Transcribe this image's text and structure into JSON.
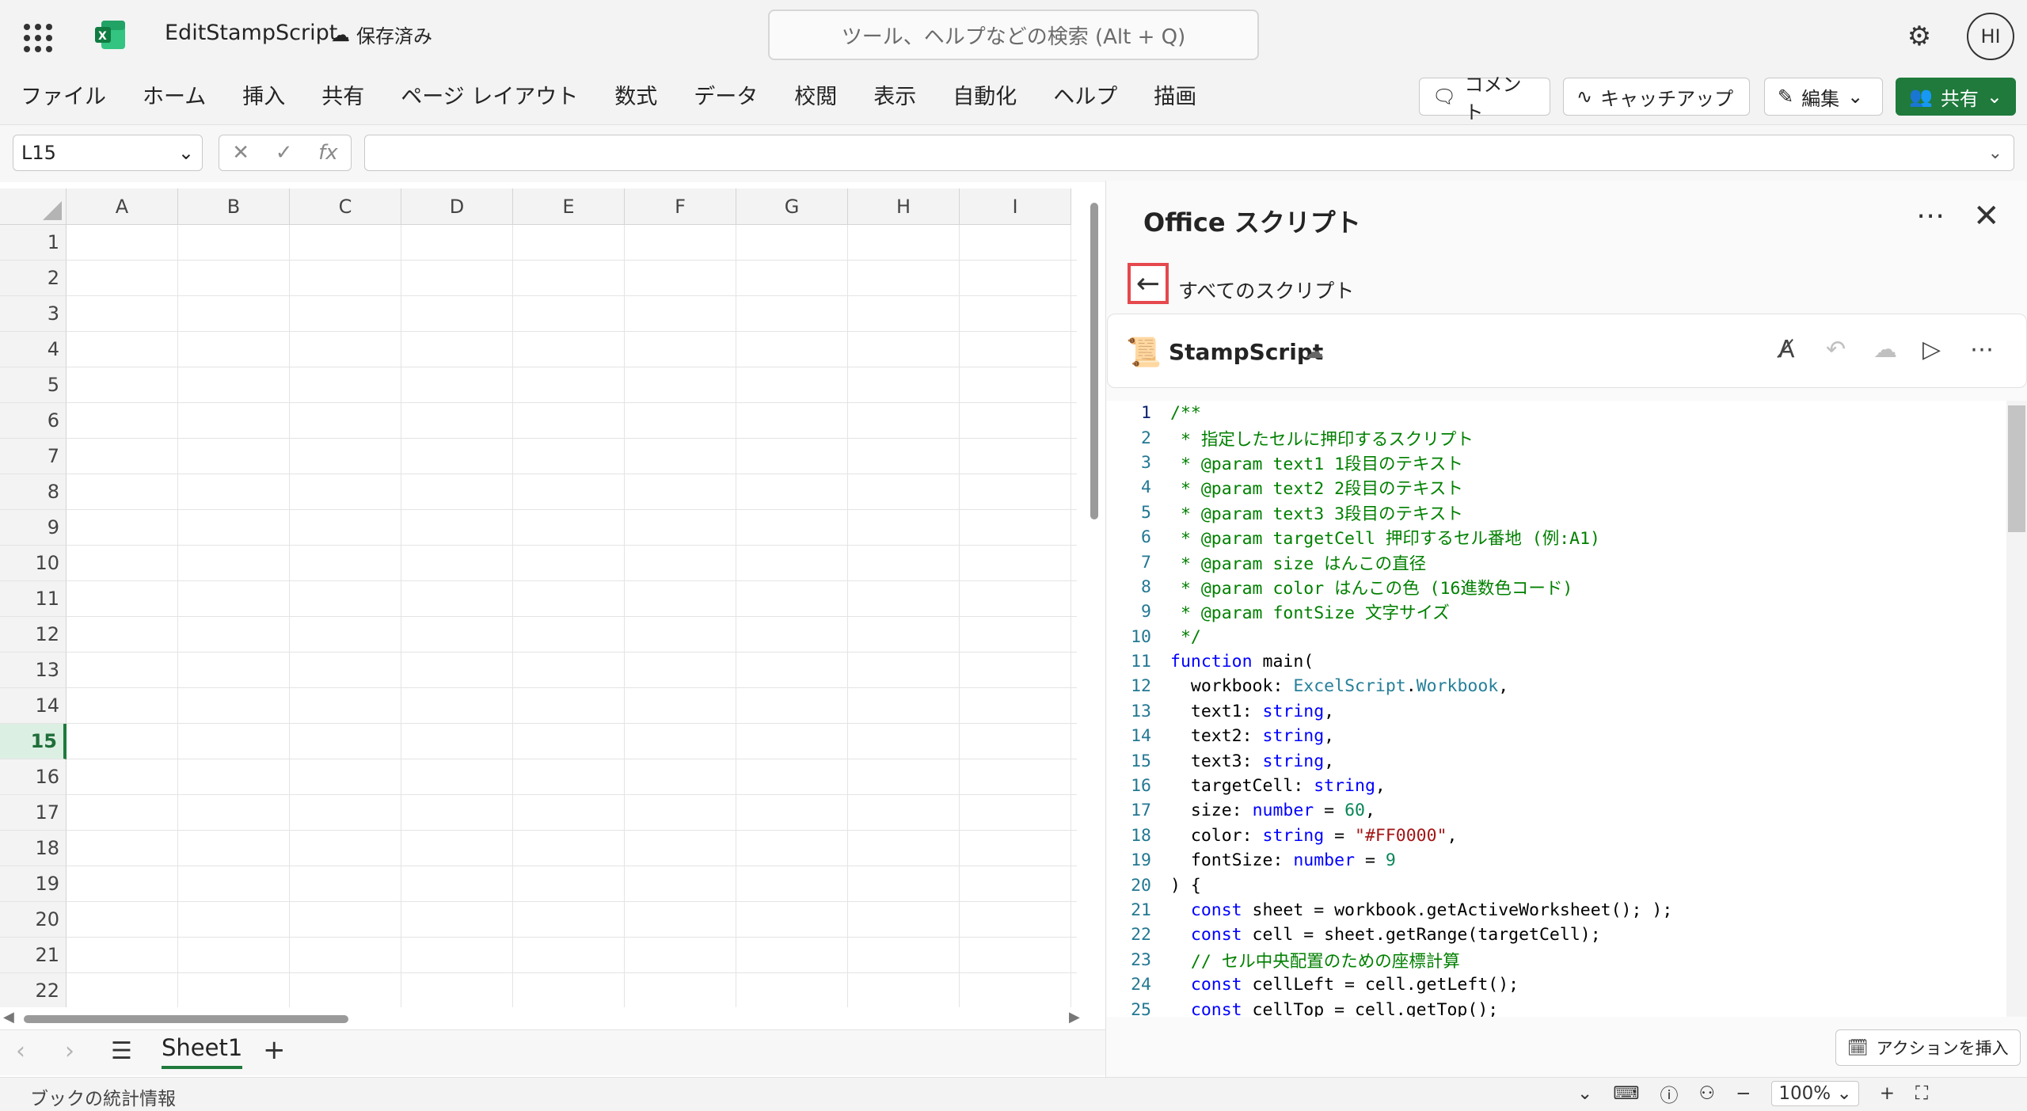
{
  "app": {
    "doc_title": "EditStampScript",
    "save_status": "保存済み",
    "search_placeholder": "ツール、ヘルプなどの検索 (Alt + Q)",
    "user_initials": "HI"
  },
  "ribbon": {
    "menus": [
      "ファイル",
      "ホーム",
      "挿入",
      "共有",
      "ページ レイアウト",
      "数式",
      "データ",
      "校閲",
      "表示",
      "自動化",
      "ヘルプ",
      "描画"
    ],
    "comment_label": "コメント",
    "catchup_label": "キャッチアップ",
    "edit_label": "編集",
    "share_label": "共有"
  },
  "formula_bar": {
    "name_box": "L15",
    "formula_value": ""
  },
  "grid": {
    "columns": [
      "A",
      "B",
      "C",
      "D",
      "E",
      "F",
      "G",
      "H",
      "I"
    ],
    "rows": [
      "1",
      "2",
      "3",
      "4",
      "5",
      "6",
      "7",
      "8",
      "9",
      "10",
      "11",
      "12",
      "13",
      "14",
      "15",
      "16",
      "17",
      "18",
      "19",
      "20",
      "21",
      "22"
    ],
    "selected_row": "15"
  },
  "sheet_tabs": {
    "active": "Sheet1",
    "add_symbol": "+"
  },
  "status_bar": {
    "stats_label": "ブックの統計情報",
    "zoom": "100%"
  },
  "script_pane": {
    "title": "Office スクリプト",
    "back_label": "すべてのスクリプト",
    "script_name": "StampScript",
    "insert_action_label": "アクションを挿入",
    "code_lines": [
      [
        {
          "t": "/**",
          "c": "com"
        }
      ],
      [
        {
          "t": " * 指定したセルに押印するスクリプト",
          "c": "com"
        }
      ],
      [
        {
          "t": " * @param text1 1段目のテキスト",
          "c": "com"
        }
      ],
      [
        {
          "t": " * @param text2 2段目のテキスト",
          "c": "com"
        }
      ],
      [
        {
          "t": " * @param text3 3段目のテキスト",
          "c": "com"
        }
      ],
      [
        {
          "t": " * @param targetCell 押印するセル番地 (例:A1)",
          "c": "com"
        }
      ],
      [
        {
          "t": " * @param size はんこの直径",
          "c": "com"
        }
      ],
      [
        {
          "t": " * @param color はんこの色 (16進数色コード)",
          "c": "com"
        }
      ],
      [
        {
          "t": " * @param fontSize 文字サイズ",
          "c": "com"
        }
      ],
      [
        {
          "t": " */",
          "c": "com"
        }
      ],
      [
        {
          "t": "function",
          "c": "kw"
        },
        {
          "t": " main(",
          "c": "def"
        }
      ],
      [
        {
          "t": "  workbook: ",
          "c": "def"
        },
        {
          "t": "ExcelScript",
          "c": "type"
        },
        {
          "t": ".",
          "c": "def"
        },
        {
          "t": "Workbook",
          "c": "type"
        },
        {
          "t": ",",
          "c": "def"
        }
      ],
      [
        {
          "t": "  text1: ",
          "c": "def"
        },
        {
          "t": "string",
          "c": "kw"
        },
        {
          "t": ",",
          "c": "def"
        }
      ],
      [
        {
          "t": "  text2: ",
          "c": "def"
        },
        {
          "t": "string",
          "c": "kw"
        },
        {
          "t": ",",
          "c": "def"
        }
      ],
      [
        {
          "t": "  text3: ",
          "c": "def"
        },
        {
          "t": "string",
          "c": "kw"
        },
        {
          "t": ",",
          "c": "def"
        }
      ],
      [
        {
          "t": "  targetCell: ",
          "c": "def"
        },
        {
          "t": "string",
          "c": "kw"
        },
        {
          "t": ",",
          "c": "def"
        }
      ],
      [
        {
          "t": "  size: ",
          "c": "def"
        },
        {
          "t": "number",
          "c": "kw"
        },
        {
          "t": " = ",
          "c": "def"
        },
        {
          "t": "60",
          "c": "num"
        },
        {
          "t": ",",
          "c": "def"
        }
      ],
      [
        {
          "t": "  color: ",
          "c": "def"
        },
        {
          "t": "string",
          "c": "kw"
        },
        {
          "t": " = ",
          "c": "def"
        },
        {
          "t": "\"#FF0000\"",
          "c": "str"
        },
        {
          "t": ",",
          "c": "def"
        }
      ],
      [
        {
          "t": "  fontSize: ",
          "c": "def"
        },
        {
          "t": "number",
          "c": "kw"
        },
        {
          "t": " = ",
          "c": "def"
        },
        {
          "t": "9",
          "c": "num"
        }
      ],
      [
        {
          "t": ") {",
          "c": "def"
        }
      ],
      [
        {
          "t": "  const",
          "c": "kw"
        },
        {
          "t": " sheet = workbook.getActiveWorksheet(); );",
          "c": "def"
        }
      ],
      [
        {
          "t": "  const",
          "c": "kw"
        },
        {
          "t": " cell = sheet.getRange(targetCell);",
          "c": "def"
        }
      ],
      [
        {
          "t": "  // セル中央配置のための座標計算",
          "c": "com"
        }
      ],
      [
        {
          "t": "  const",
          "c": "kw"
        },
        {
          "t": " cellLeft = cell.getLeft();",
          "c": "def"
        }
      ],
      [
        {
          "t": "  const",
          "c": "kw"
        },
        {
          "t": " cellTop = cell.getTop();",
          "c": "def"
        }
      ]
    ]
  },
  "colors": {
    "excel_green": "#1f7a3c",
    "highlight_red": "#e5484d",
    "comment_green": "#008000",
    "keyword_blue": "#0000ff"
  }
}
